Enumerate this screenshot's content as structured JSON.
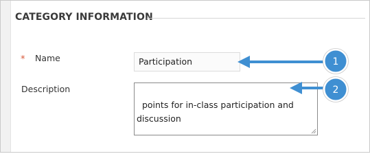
{
  "section": {
    "title": "CATEGORY INFORMATION"
  },
  "fields": {
    "name": {
      "required_mark": "*",
      "label": "Name",
      "value": "Participation"
    },
    "description": {
      "label": "Description",
      "value": "points for in-class participation and\ndiscussion"
    }
  },
  "callouts": [
    {
      "number": "1"
    },
    {
      "number": "2"
    }
  ],
  "colors": {
    "callout_fill": "#3f8fd2",
    "callout_border": "#ffffff",
    "arrow": "#3f8fd2",
    "required": "#d8593a"
  }
}
